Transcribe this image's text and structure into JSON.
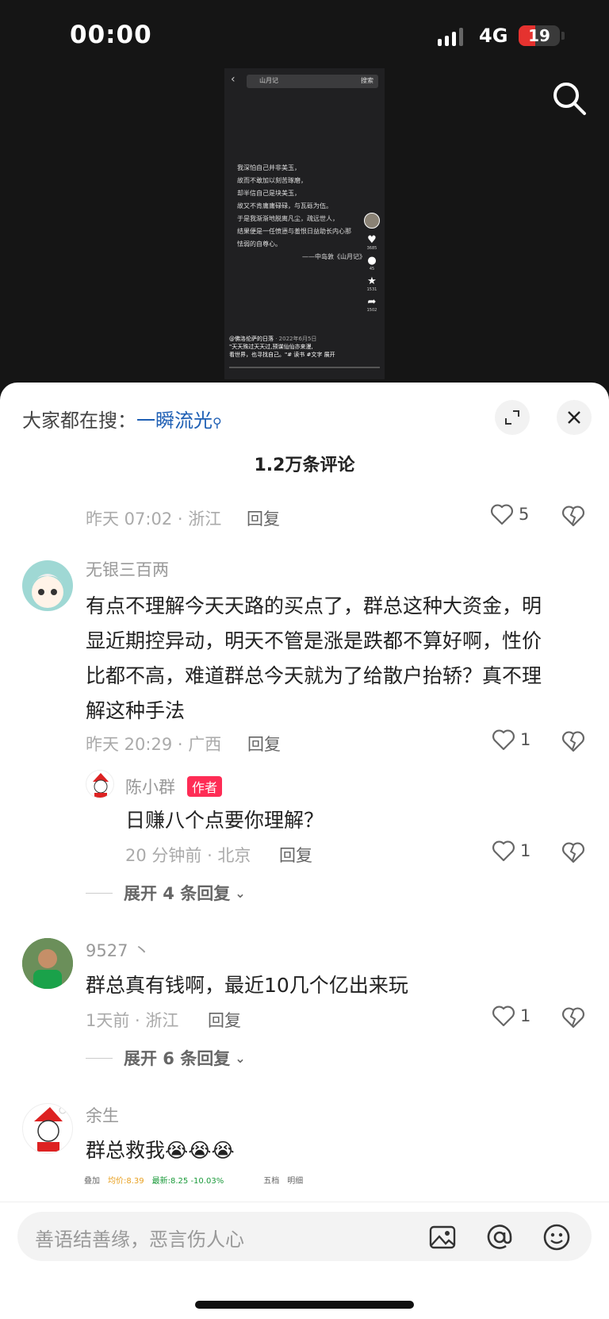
{
  "status": {
    "time": "00:00",
    "network": "4G",
    "battery": "19",
    "battery_level": 0.19
  },
  "video": {
    "search_query": "山月记",
    "search_button": "搜索",
    "poem_lines": [
      "我深怕自己并非美玉，",
      "故而不敢加以刻苦琢磨，",
      "却半信自己是块美玉，",
      "故又不肯庸庸碌碌，与瓦砾为伍。",
      "于是我渐渐地脱离凡尘，疏远世人，",
      "结果便是一任愤懑与羞恨日益助长内心那",
      "怯弱的自尊心。"
    ],
    "poem_signature": "——中岛敦《山月记》",
    "likes": "3685",
    "comments": "45",
    "favorites": "1531",
    "shares": "1502",
    "author": "@佛洛伦萨的日落",
    "date": "· 2022年6月5日",
    "caption1": "\"天天殊过天天过,预谋仙仙亦来漫,",
    "caption2": "看世界，也寻找自己。\"# 读书 #文字 展开"
  },
  "sheet": {
    "hot_search_prefix": "大家都在搜：",
    "hot_search_term": "一瞬流光",
    "comment_count": "1.2万条评论",
    "reply_label": "回复",
    "input_placeholder": "善语结善缘，恶言伤人心",
    "author_badge": "作者"
  },
  "comments": [
    {
      "meta": "昨天 07:02 · 浙江",
      "likes": "5"
    },
    {
      "user": "无银三百两",
      "text_lines": [
        "有点不理解今天天路的买点了，群总这种大资金，明",
        "显近期控异动，明天不管是涨是跌都不算好啊，性价",
        "比都不高，难道群总今天就为了给散户抬轿？真不理",
        "解这种手法"
      ],
      "meta": "昨天 20:29 · 广西",
      "likes": "1"
    },
    {
      "user": "陈小群",
      "text": "日赚八个点要你理解？",
      "meta": "20 分钟前 · 北京",
      "likes": "1"
    },
    {
      "expand": "展开 4 条回复"
    },
    {
      "user": "9527 丶",
      "text": "群总真有钱啊，最近10几个亿出来玩",
      "meta": "1天前 · 浙江",
      "likes": "1"
    },
    {
      "expand": "展开 6 条回复"
    },
    {
      "user": "余生",
      "text": "群总救我",
      "emoji": "😭😭😭"
    }
  ],
  "stock_strip": {
    "label": "叠加",
    "avg": "均价:8.39",
    "latest": "最新:8.25 -10.03%",
    "tab1": "五档",
    "tab2": "明细"
  }
}
